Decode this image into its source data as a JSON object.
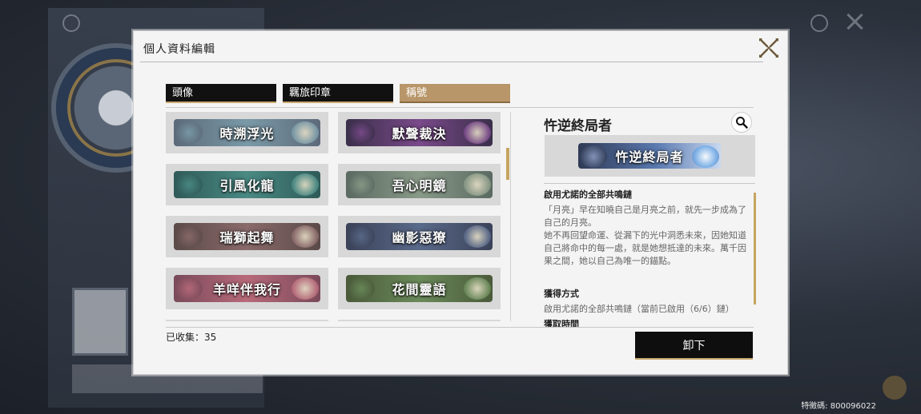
{
  "modal": {
    "title": "個人資料編輯",
    "close_icon": "close-x-icon"
  },
  "tabs": [
    {
      "label": "頭像",
      "active": false
    },
    {
      "label": "羈旅印章",
      "active": false
    },
    {
      "label": "稱號",
      "active": true
    }
  ],
  "titles": [
    {
      "label": "時溯浮光",
      "colors": [
        "#5c6a7a",
        "#7a9aa8"
      ]
    },
    {
      "label": "默聲裁決",
      "colors": [
        "#3a2f4a",
        "#7a4a8a"
      ]
    },
    {
      "label": "引風化龍",
      "colors": [
        "#2f5a58",
        "#4a8a84"
      ]
    },
    {
      "label": "吾心明鏡",
      "colors": [
        "#5a6a62",
        "#8a9a88"
      ]
    },
    {
      "label": "瑞獅起舞",
      "colors": [
        "#5a4a48",
        "#8a6a6a"
      ]
    },
    {
      "label": "幽影惡獠",
      "colors": [
        "#3a4258",
        "#5a6a8a"
      ]
    },
    {
      "label": "羊咩伴我行",
      "colors": [
        "#7a4a5a",
        "#b86a7a"
      ]
    },
    {
      "label": "花間靈語",
      "colors": [
        "#4a5a3a",
        "#6a8a5a"
      ]
    }
  ],
  "collected": "已收集：35",
  "detail": {
    "name": "忤逆終局者",
    "preview_label": "忤逆終局者",
    "preview_colors": [
      "#2f3a55",
      "#5a7ab0"
    ],
    "condition_title": "啟用尤諾的全部共鳴鏈",
    "description": "「月亮」早在知曉自己是月亮之前，就先一步成為了自己的月亮。\n她不再回望命運、從漏下的光中洞悉未來，因她知道自己將命中的每一處，就是她想抵達的未來。萬千因果之間，她以自己為唯一的錨點。",
    "obtain_title": "獲得方式",
    "obtain_text": "啟用尤諾的全部共鳴鏈（當前已啟用（6/6）鏈）",
    "time_title": "獲取時間"
  },
  "unequip_label": "卸下",
  "uid": "特徵碼: 800096022",
  "search_icon": "magnifier-icon"
}
